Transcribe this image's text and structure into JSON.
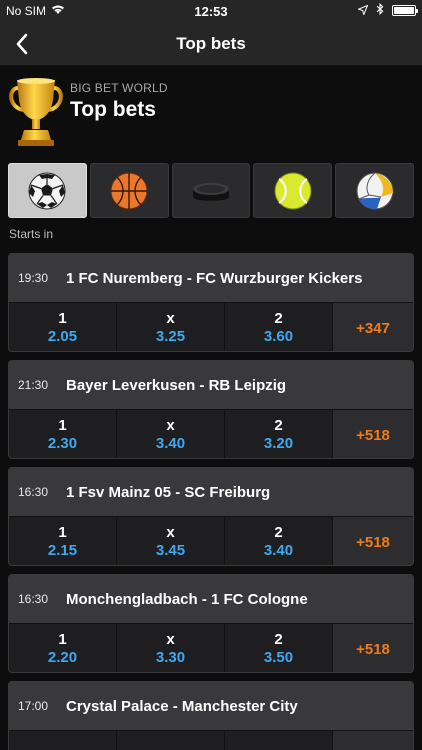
{
  "status_bar": {
    "carrier": "No SIM",
    "time": "12:53"
  },
  "nav": {
    "title": "Top bets"
  },
  "header": {
    "subtitle": "BIG BET WORLD",
    "title": "Top bets"
  },
  "sports": [
    "football",
    "basketball",
    "ice hockey",
    "tennis",
    "volleyball"
  ],
  "starts_in_label": "Starts in",
  "odds_labels": {
    "home": "1",
    "draw": "x",
    "away": "2"
  },
  "colors": {
    "odds_value": "#3ea9f0",
    "more_bets": "#f07a1e"
  },
  "matches": [
    {
      "time": "19:30",
      "teams": "1 FC Nuremberg - FC Wurzburger Kickers",
      "odds": [
        "2.05",
        "3.25",
        "3.60"
      ],
      "more": "+347"
    },
    {
      "time": "21:30",
      "teams": "Bayer Leverkusen - RB Leipzig",
      "odds": [
        "2.30",
        "3.40",
        "3.20"
      ],
      "more": "+518"
    },
    {
      "time": "16:30",
      "teams": "1 Fsv Mainz 05 - SC Freiburg",
      "odds": [
        "2.15",
        "3.45",
        "3.40"
      ],
      "more": "+518"
    },
    {
      "time": "16:30",
      "teams": "Monchengladbach - 1 FC Cologne",
      "odds": [
        "2.20",
        "3.30",
        "3.50"
      ],
      "more": "+518"
    },
    {
      "time": "17:00",
      "teams": "Crystal Palace - Manchester City",
      "odds": [
        "",
        "",
        ""
      ],
      "more": ""
    }
  ]
}
